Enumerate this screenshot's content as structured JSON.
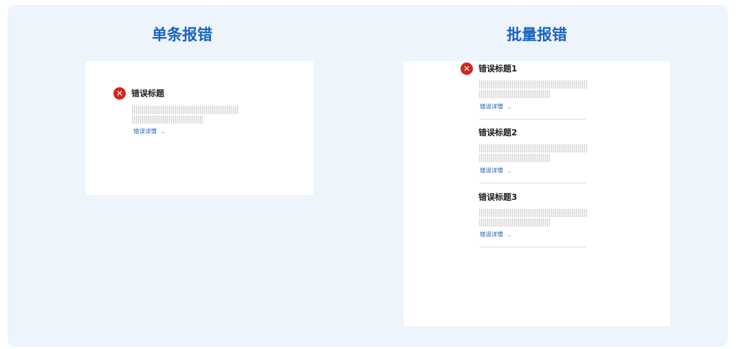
{
  "single": {
    "heading": "单条报错",
    "title": "错误标题",
    "details_link": "错误详情"
  },
  "batch": {
    "heading": "批量报错",
    "items": [
      {
        "title": "错误标题1",
        "details_link": "错误详情"
      },
      {
        "title": "错误标题2",
        "details_link": "错误详情"
      },
      {
        "title": "错误标题3",
        "details_link": "错误详情"
      }
    ]
  },
  "icons": {
    "error": "error-x-circle-icon",
    "chevron": "chevron-down-icon"
  },
  "colors": {
    "heading": "#1a63c0",
    "error": "#d0271f",
    "link": "#1f5fb5",
    "panel_bg": "#edf4fb"
  }
}
